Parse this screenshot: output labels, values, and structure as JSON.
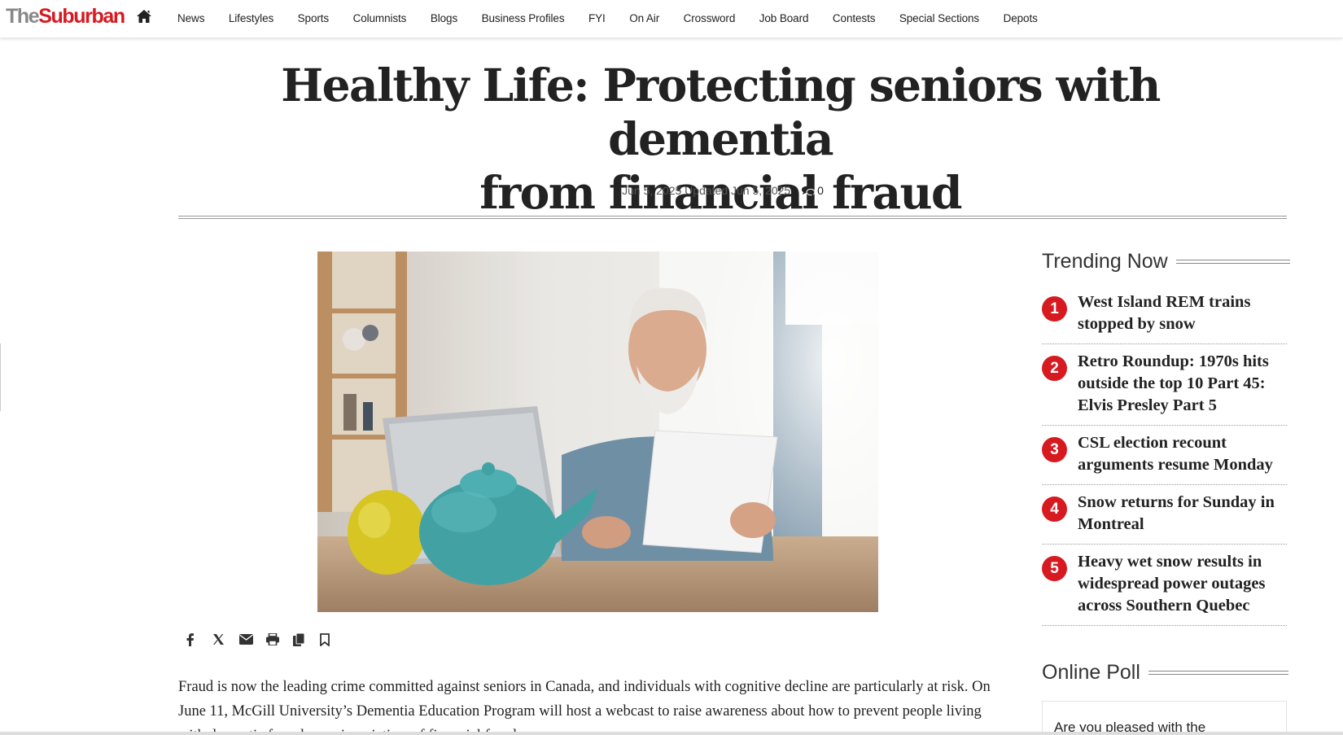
{
  "logo": {
    "the": "The",
    "suburban": "Suburban"
  },
  "nav": {
    "home_icon": "home-icon",
    "items": [
      "News",
      "Lifestyles",
      "Sports",
      "Columnists",
      "Blogs",
      "Business Profiles",
      "FYI",
      "On Air",
      "Crossword",
      "Job Board",
      "Contests",
      "Special Sections",
      "Depots"
    ]
  },
  "article": {
    "title_line1": "Healthy Life: Protecting seniors with dementia",
    "title_line2": "from financial fraud",
    "dates": "Jun 5, 2025 Updated Jun 5, 2025",
    "comment_count": "0",
    "share_icons": [
      "facebook-icon",
      "x-icon",
      "email-icon",
      "print-icon",
      "copy-icon",
      "bookmark-icon"
    ],
    "body": "Fraud is now the leading crime committed against seniors in Canada, and individuals with cognitive decline are particularly at risk. On June 11, McGill University’s Dementia Education Program will host a webcast to raise awareness about how to prevent people living with dementia from becoming victims of financial fraud."
  },
  "sidebar": {
    "trending_title": "Trending Now",
    "trending": [
      {
        "num": "1",
        "text": "West Island REM trains stopped by snow"
      },
      {
        "num": "2",
        "text": "Retro Roundup: 1970s hits outside the top 10 Part 45: Elvis Presley Part 5"
      },
      {
        "num": "3",
        "text": "CSL election recount arguments resume Monday"
      },
      {
        "num": "4",
        "text": "Snow returns for Sunday in Montreal"
      },
      {
        "num": "5",
        "text": "Heavy wet snow results in widespread power outages across Southern Quebec"
      }
    ],
    "poll_title": "Online Poll",
    "poll_question": "Are you pleased with the"
  },
  "colors": {
    "brand_red": "#d71920",
    "logo_gray": "#888888"
  }
}
